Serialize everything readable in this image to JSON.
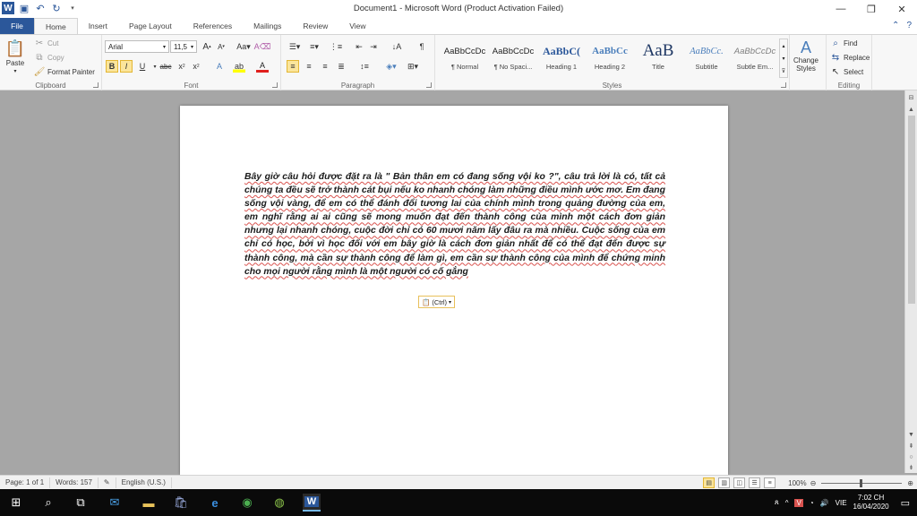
{
  "window": {
    "title": "Document1  -  Microsoft Word (Product Activation Failed)"
  },
  "tabs": [
    "File",
    "Home",
    "Insert",
    "Page Layout",
    "References",
    "Mailings",
    "Review",
    "View"
  ],
  "clipboard": {
    "paste": "Paste",
    "cut": "Cut",
    "copy": "Copy",
    "format_painter": "Format Painter",
    "label": "Clipboard"
  },
  "font": {
    "name": "Arial",
    "size": "11,5",
    "label": "Font"
  },
  "paragraph": {
    "label": "Paragraph"
  },
  "styles": {
    "label": "Styles",
    "items": [
      {
        "sample": "AaBbCcDc",
        "name": "¶ Normal"
      },
      {
        "sample": "AaBbCcDc",
        "name": "¶ No Spaci..."
      },
      {
        "sample": "AaBbC(",
        "name": "Heading 1"
      },
      {
        "sample": "AaBbCc",
        "name": "Heading 2"
      },
      {
        "sample": "AaB",
        "name": "Title"
      },
      {
        "sample": "AaBbCc.",
        "name": "Subtitle"
      },
      {
        "sample": "AaBbCcDc",
        "name": "Subtle Em..."
      }
    ],
    "change_styles": "Change Styles"
  },
  "editing": {
    "find": "Find",
    "replace": "Replace",
    "select": "Select",
    "label": "Editing"
  },
  "document": {
    "text": "Bây giờ câu hỏi được đặt ra là \" Bản thân em có đang sống vội ko ?\", câu trả lời là có, tất cả chúng ta đều sẽ trở thành cát bụi nếu ko nhanh chóng làm những điều mình ước mơ. Em đang sống vội vàng, để em có thể đánh đổi tương lai của chính mình trong quảng đường của em, em nghĩ rằng ai ai cũng sẽ mong muốn đạt đến thành công của mình một cách đơn giản nhưng lại nhanh chóng, cuộc đời chỉ có 60 mươi năm lấy đâu ra mà nhiều. Cuộc sống của em chỉ có học, bởi vì học đối với em bây giờ là cách đơn giản nhất để có thể đạt đến được sự thành công, mà cần sự thành công để làm gì, em cần sự thành công của mình để chứng minh cho mọi người rằng mình là một người có cố gắng",
    "paste_options": "(Ctrl)"
  },
  "statusbar": {
    "page": "Page: 1 of 1",
    "words": "Words: 157",
    "language": "English (U.S.)",
    "zoom": "100%"
  },
  "taskbar": {
    "language": "VIE",
    "time": "7:02 CH",
    "date": "16/04/2020"
  }
}
